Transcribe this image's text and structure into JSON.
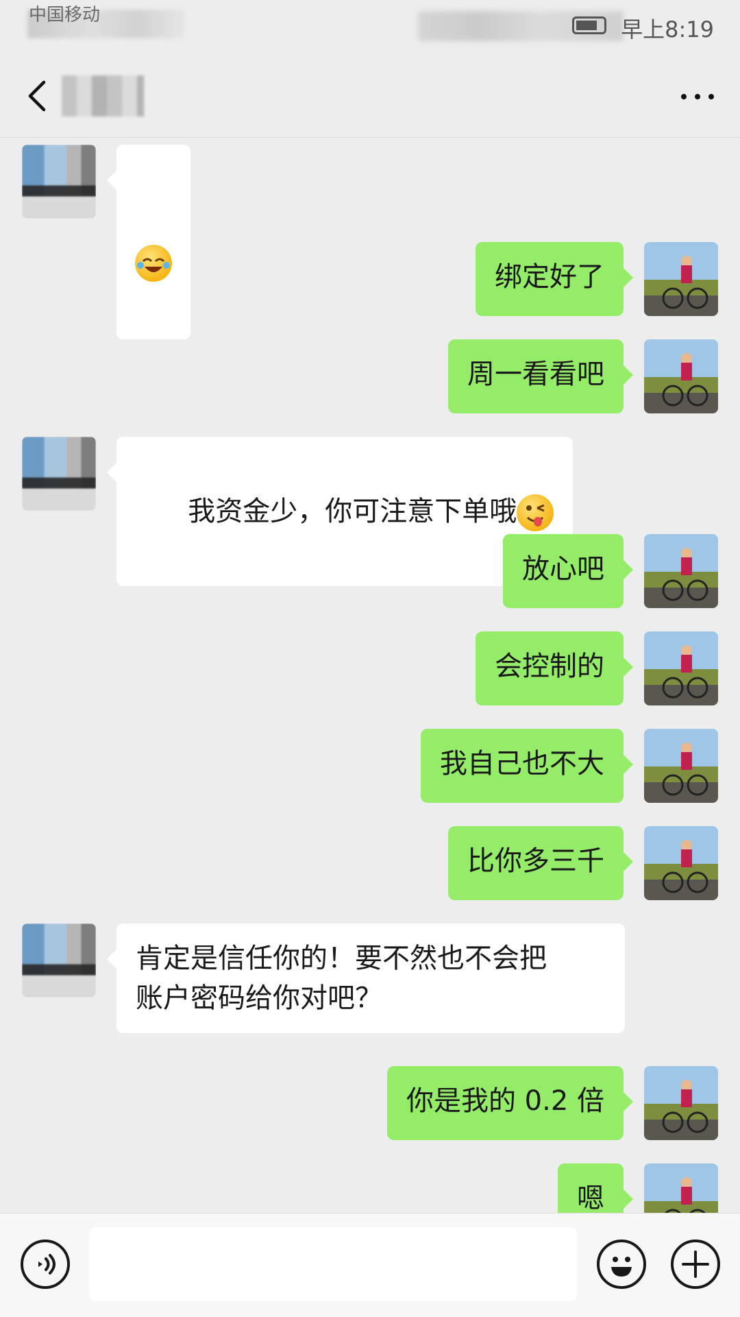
{
  "status_bar": {
    "carrier": "中国移动",
    "time": "早上8:19",
    "battery_percent": "64%"
  },
  "header": {
    "title": "",
    "back_icon": "chevron-left-icon",
    "more_icon": "more-horizontal-icon"
  },
  "messages": [
    {
      "from": "other",
      "text": "",
      "emoji": "laughing-crying-emoji"
    },
    {
      "from": "self",
      "text": "绑定好了"
    },
    {
      "from": "self",
      "text": "周一看看吧"
    },
    {
      "from": "other",
      "text": "我资金少，你可注意下单哦",
      "emoji": "winking-tongue-emoji"
    },
    {
      "from": "self",
      "text": "放心吧"
    },
    {
      "from": "self",
      "text": "会控制的"
    },
    {
      "from": "self",
      "text": "我自己也不大"
    },
    {
      "from": "self",
      "text": "比你多三千"
    },
    {
      "from": "other",
      "text": "肯定是信任你的！要不然也不会把\n账户密码给你对吧？"
    },
    {
      "from": "self",
      "text": "你是我的 0.2 倍"
    },
    {
      "from": "self",
      "text": "嗯"
    }
  ],
  "input_bar": {
    "voice_icon": "voice-icon",
    "input_value": "",
    "emoji_icon": "emoji-icon",
    "plus_icon": "plus-icon"
  },
  "colors": {
    "background": "#ededed",
    "self_bubble": "#95ec69",
    "other_bubble": "#ffffff"
  }
}
